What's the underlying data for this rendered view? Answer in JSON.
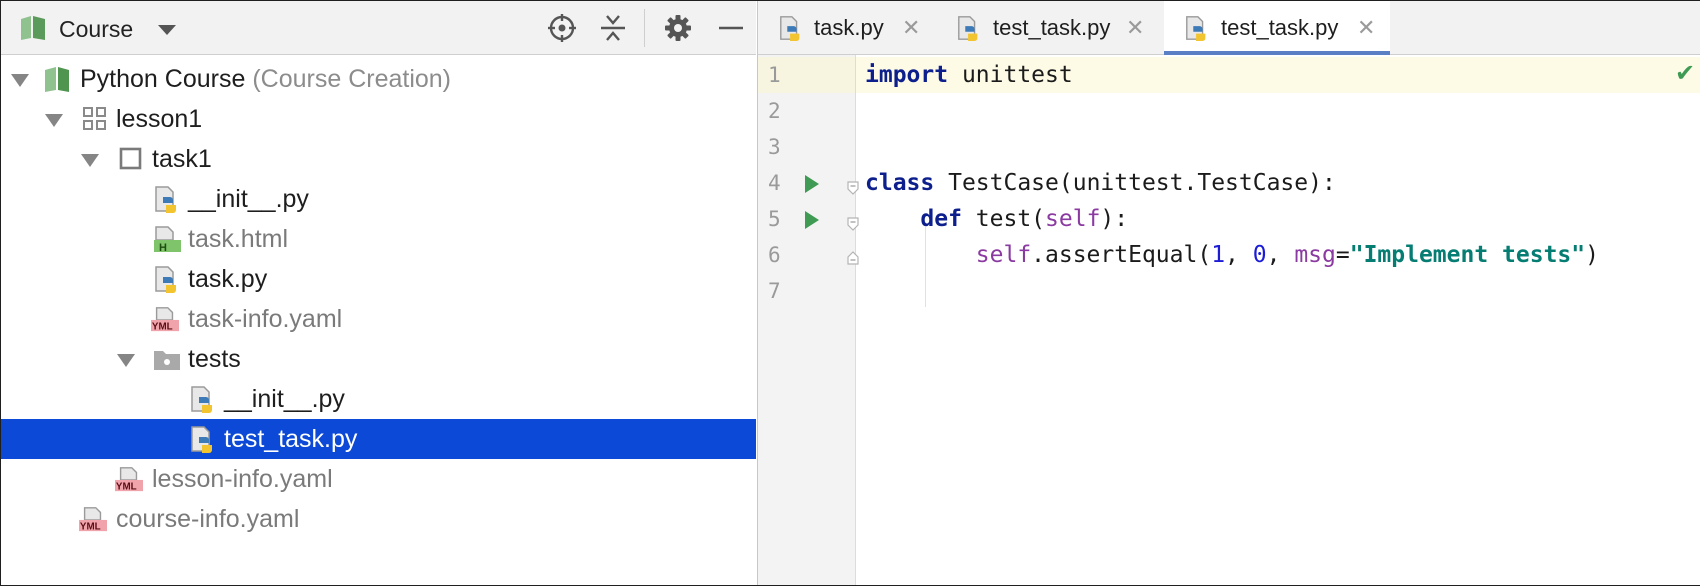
{
  "project_panel": {
    "title": "Course",
    "toolbar": {
      "locate": "locate-icon",
      "collapse": "collapse-all-icon",
      "settings": "gear-icon",
      "hide": "minimize-icon"
    },
    "tree": [
      {
        "label": "Python Course",
        "suffix": "(Course Creation)",
        "icon": "course-icon"
      },
      {
        "label": "lesson1",
        "icon": "lesson-icon"
      },
      {
        "label": "task1",
        "icon": "task-icon"
      },
      {
        "label": "__init__.py",
        "icon": "python-file-icon"
      },
      {
        "label": "task.html",
        "icon": "html-file-icon",
        "badge": "H"
      },
      {
        "label": "task.py",
        "icon": "python-file-icon"
      },
      {
        "label": "task-info.yaml",
        "icon": "yaml-file-icon",
        "badge": "YML"
      },
      {
        "label": "tests",
        "icon": "folder-icon"
      },
      {
        "label": "__init__.py",
        "icon": "python-file-icon"
      },
      {
        "label": "test_task.py",
        "icon": "python-file-icon",
        "selected": true
      },
      {
        "label": "lesson-info.yaml",
        "icon": "yaml-file-icon",
        "badge": "YML"
      },
      {
        "label": "course-info.yaml",
        "icon": "yaml-file-icon",
        "badge": "YML"
      }
    ]
  },
  "editor": {
    "tabs": [
      {
        "label": "task.py",
        "close": "✕"
      },
      {
        "label": "test_task.py",
        "close": "✕"
      },
      {
        "label": "test_task.py",
        "close": "✕",
        "active": true
      }
    ],
    "line_numbers": [
      "1",
      "2",
      "3",
      "4",
      "5",
      "6",
      "7"
    ],
    "code": {
      "l1_kw": "import",
      "l1_rest": " unittest",
      "l4_kw": "class",
      "l4_rest": " TestCase(unittest.TestCase):",
      "l5_indent": "    ",
      "l5_kw": "def",
      "l5_a": " test(",
      "l5_self": "self",
      "l5_b": "):",
      "l6_indent": "        ",
      "l6_self": "self",
      "l6_a": ".assertEqual(",
      "l6_n1": "1",
      "l6_c1": ", ",
      "l6_n2": "0",
      "l6_c2": ", ",
      "l6_msg": "msg",
      "l6_eq": "=",
      "l6_str": "\"Implement tests\"",
      "l6_end": ")"
    },
    "status_check": "✔"
  },
  "colors": {
    "selection": "#0b49d6",
    "keyword": "#0d1f8c",
    "self": "#8a3aa0",
    "number": "#1c1cd6",
    "string": "#067d72",
    "run": "#3f9b54"
  }
}
